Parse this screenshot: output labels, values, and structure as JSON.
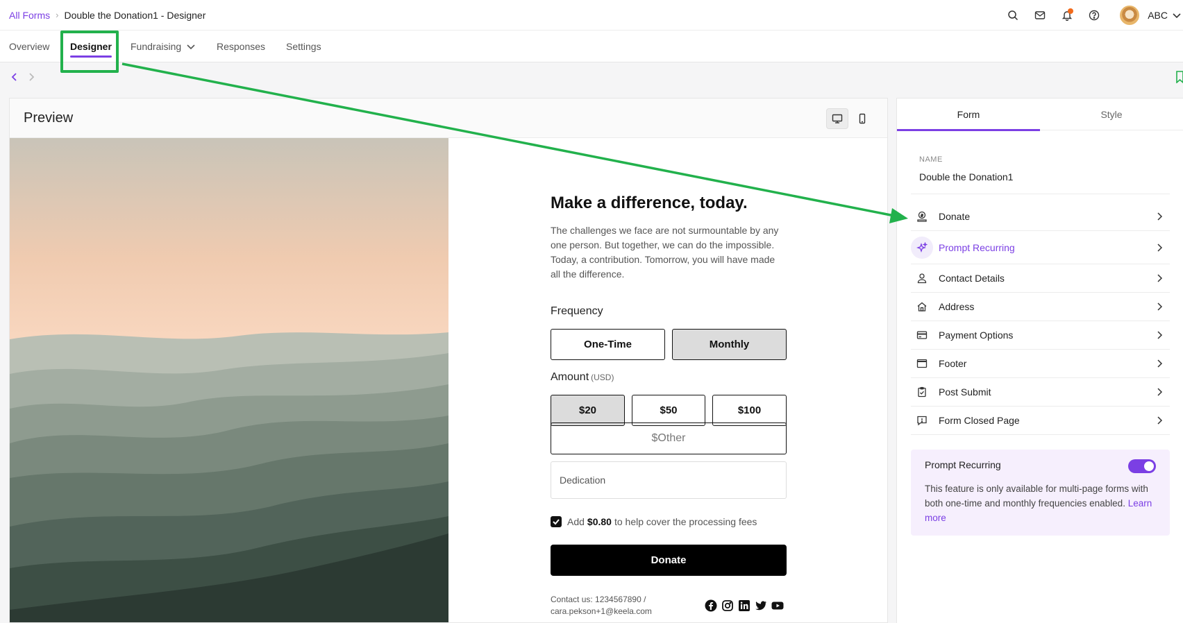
{
  "breadcrumb": {
    "root": "All Forms",
    "separator": "›",
    "current": "Double the Donation1 - Designer"
  },
  "header": {
    "user_name": "ABC"
  },
  "nav": {
    "tabs": [
      "Overview",
      "Designer",
      "Fundraising",
      "Responses",
      "Settings"
    ],
    "active": "Designer"
  },
  "preview": {
    "title": "Preview"
  },
  "form_preview": {
    "headline": "Make a difference, today.",
    "blurb": "The challenges we face are not surmountable by any one person. But together, we can do the impossible. Today, a contribution. Tomorrow, you will have made all the difference.",
    "frequency_label": "Frequency",
    "frequencies": [
      "One-Time",
      "Monthly"
    ],
    "selected_frequency": "Monthly",
    "amount_label": "Amount",
    "amount_currency": "(USD)",
    "amounts": [
      "$20",
      "$50",
      "$100"
    ],
    "selected_amount": "$20",
    "other_placeholder": "$Other",
    "dedication_placeholder": "Dedication",
    "fee_prefix": "Add",
    "fee_amount": "$0.80",
    "fee_suffix": "to help cover the processing fees",
    "fee_checked": true,
    "donate_label": "Donate",
    "contact_text": "Contact us: 1234567890 / cara.pekson+1@keela.com",
    "social_icons": [
      "facebook-icon",
      "instagram-icon",
      "linkedin-icon",
      "twitter-icon",
      "youtube-icon"
    ]
  },
  "panel": {
    "tabs": [
      "Form",
      "Style"
    ],
    "active_tab": "Form",
    "name_label": "NAME",
    "name_value": "Double the Donation1",
    "sections": [
      "Donate",
      "Prompt Recurring",
      "Contact Details",
      "Address",
      "Payment Options",
      "Footer",
      "Post Submit",
      "Form Closed Page"
    ],
    "active_section": "Prompt Recurring",
    "info": {
      "title": "Prompt Recurring",
      "toggle_on": true,
      "text": "This feature is only available for multi-page forms with both one-time and monthly frequencies enabled.",
      "link": "Learn more"
    }
  },
  "colors": {
    "accent": "#7b3fe4",
    "annotation": "#22b14c",
    "notification": "#f26a1b",
    "info_bg": "#f6effd"
  }
}
